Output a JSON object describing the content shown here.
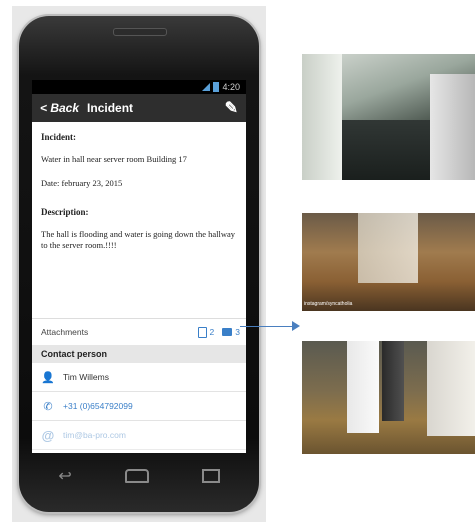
{
  "status": {
    "time": "4:20"
  },
  "actionbar": {
    "back_label": "< Back",
    "title": "Incident"
  },
  "incident": {
    "heading": "Incident:",
    "text": "Water in hall near server room  Building 17",
    "date": "Date: february 23, 2015",
    "description_heading": "Description:",
    "description": "The hall is flooding  and water is going down the hallway to the server room.!!!!"
  },
  "attachments": {
    "label": "Attachments",
    "doc_count": "2",
    "image_count": "3"
  },
  "contact": {
    "heading": "Contact person",
    "name": "Tim Willems",
    "phone": "+31 (0)654792099",
    "email": "tim@ba-pro.com"
  },
  "photos": {
    "photo2_caption": "instagram/syncatholia"
  },
  "colors": {
    "accent": "#3a7fc8",
    "actionbar": "#2e2e2e",
    "arrow": "#4a7fbf"
  },
  "icons": {
    "edit": "pencil-icon",
    "person": "person-icon",
    "phone": "phone-icon",
    "email": "at-icon"
  }
}
